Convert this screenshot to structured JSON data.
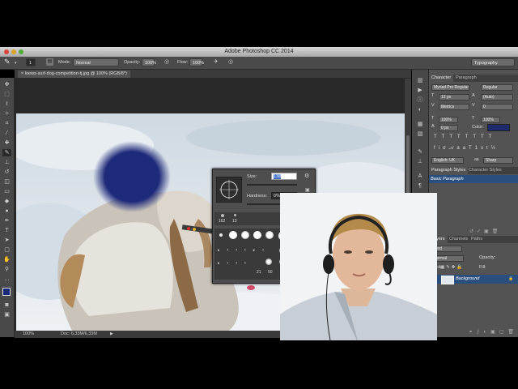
{
  "window": {
    "title": "Adobe Photoshop CC 2014"
  },
  "options_bar": {
    "brush_size": "1",
    "mode_label": "Mode:",
    "mode_value": "Normal",
    "opacity_label": "Opacity:",
    "opacity_value": "100%",
    "flow_label": "Flow:",
    "flow_value": "100%",
    "workspace": "Typography"
  },
  "document": {
    "tab_label": "loews-surf-dog-competition-tj.jpg @ 100% (RGB/8*)",
    "zoom": "100%",
    "doc_size": "Doc: 6,33M/6,33M"
  },
  "brush_picker": {
    "size_label": "Size:",
    "size_value": "138",
    "hardness_label": "Hardness:",
    "hardness_value": "0%",
    "recent": [
      "162",
      "13"
    ],
    "grid_numbers": [
      "21",
      "50"
    ]
  },
  "character_panel": {
    "tabs": [
      "Character",
      "Paragraph"
    ],
    "font_family": "Myriad Pro Regular",
    "font_style": "Regular",
    "font_size": "12 px",
    "leading": "(Auto)",
    "kerning": "Metrics",
    "tracking": "0",
    "vertical_scale": "100%",
    "horizontal_scale": "100%",
    "baseline_shift": "0 px",
    "color_label": "Color:",
    "language": "English: UK",
    "aa_label": "aa",
    "antialias": "Sharp"
  },
  "styles_panel": {
    "tabs": [
      "Paragraph Styles",
      "Character Styles"
    ],
    "item": "Basic Paragraph"
  },
  "layers_panel": {
    "tabs": [
      "Layers",
      "Channels",
      "Paths"
    ],
    "kind": "Kind",
    "blend_mode": "Normal",
    "opacity_label": "Opacity:",
    "lock_label": "Lock:",
    "fill_label": "Fill:",
    "layer_name": "Background"
  },
  "colors": {
    "brush_stroke": "#1e2a7a",
    "selection": "#2a4f7f",
    "text_color_swatch": "#1e2a6a"
  },
  "icons": [
    "brush-icon",
    "move-icon",
    "lasso-icon",
    "crop-icon",
    "eyedropper-icon",
    "eraser-icon",
    "text-icon",
    "zoom-icon"
  ]
}
